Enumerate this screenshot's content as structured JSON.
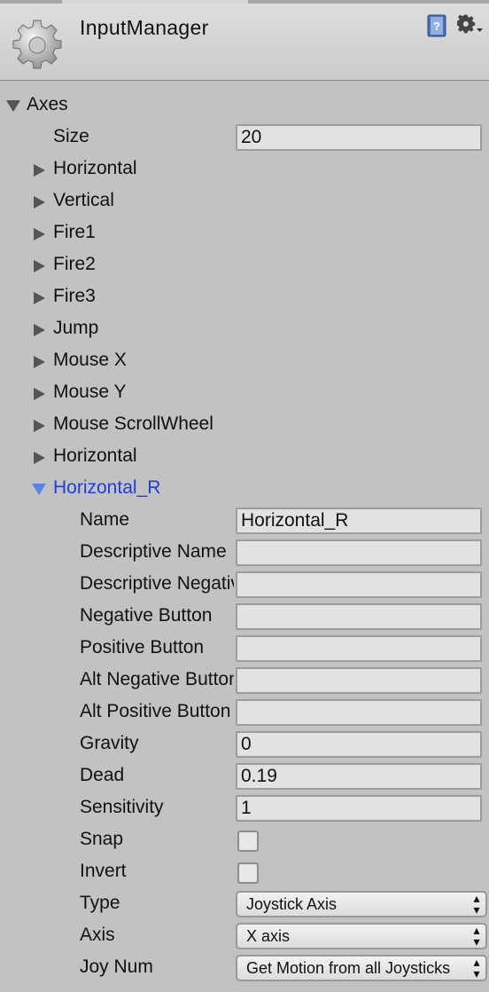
{
  "header": {
    "title": "InputManager",
    "icons": [
      "gear-icon",
      "help-icon",
      "settings-icon"
    ]
  },
  "axes": {
    "label": "Axes",
    "size_label": "Size",
    "size_value": "20",
    "items": [
      "Horizontal",
      "Vertical",
      "Fire1",
      "Fire2",
      "Fire3",
      "Jump",
      "Mouse X",
      "Mouse Y",
      "Mouse ScrollWheel",
      "Horizontal"
    ],
    "expanded_item": "Horizontal_R"
  },
  "props": {
    "name_label": "Name",
    "name_value": "Horizontal_R",
    "desc_name_label": "Descriptive Name",
    "desc_name_value": "",
    "desc_neg_label": "Descriptive Negative Name",
    "desc_neg_value": "",
    "neg_btn_label": "Negative Button",
    "neg_btn_value": "",
    "pos_btn_label": "Positive Button",
    "pos_btn_value": "",
    "alt_neg_label": "Alt Negative Button",
    "alt_neg_value": "",
    "alt_pos_label": "Alt Positive Button",
    "alt_pos_value": "",
    "gravity_label": "Gravity",
    "gravity_value": "0",
    "dead_label": "Dead",
    "dead_value": "0.19",
    "sens_label": "Sensitivity",
    "sens_value": "1",
    "snap_label": "Snap",
    "snap_checked": false,
    "invert_label": "Invert",
    "invert_checked": false,
    "type_label": "Type",
    "type_value": "Joystick Axis",
    "axis_label": "Axis",
    "axis_value": "X axis",
    "joynum_label": "Joy Num",
    "joynum_value": "Get Motion from all Joysticks"
  },
  "colors": {
    "background": "#c2c2c2",
    "selected_text": "#1d3fd8",
    "field_bg": "#e2e2e2"
  }
}
